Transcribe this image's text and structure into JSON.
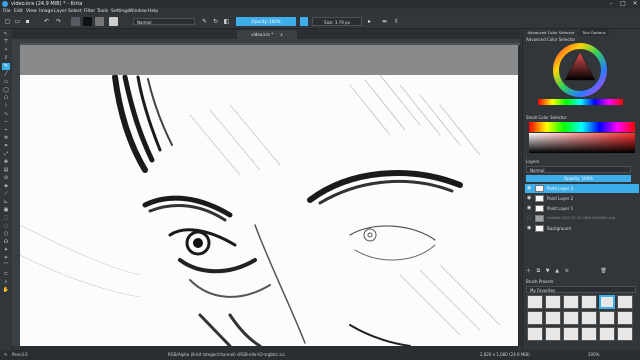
{
  "window": {
    "title": "video.kra (24.9 MiB) * - Krita",
    "minimize": "–",
    "maximize": "□",
    "close": "✕"
  },
  "menu": [
    "File",
    "Edit",
    "View",
    "Image",
    "Layer",
    "Select",
    "Filter",
    "Tools",
    "Settings",
    "Window",
    "Help"
  ],
  "toolbar": {
    "blend_mode": "Normal",
    "opacity_label": "Opacity: 100%",
    "size_label": "Size: 3.79 px"
  },
  "document_tab": {
    "label": "video.kra *",
    "close": "x"
  },
  "dock": {
    "color_tabs": [
      "Advanced Color Selector",
      "Tool Options"
    ],
    "advanced_color_selector_label": "Advanced Color Selector",
    "small_color_selector_label": "Small Color Selector",
    "layers_title": "Layers",
    "blend_mode": "Normal",
    "opacity_label": "Opacity: 100%",
    "layers": [
      {
        "name": "Paint Layer 3",
        "selected": true
      },
      {
        "name": "Paint Layer 2",
        "selected": false
      },
      {
        "name": "Paint Layer 1",
        "selected": false
      },
      {
        "name": "Untitled-2022-07-12-0849-800x800.png",
        "selected": false,
        "dim": true
      },
      {
        "name": "Background",
        "selected": false
      }
    ],
    "brush_presets_title": "Brush Presets",
    "brush_tag": "My Favorites"
  },
  "status": {
    "brush": "Pencil-2",
    "color_info": "RGB/Alpha (8-bit integer/channel)  sRGB-elle-V2-srgbtrc.icc",
    "dimensions": "2,820 x 1,080 (24.9 MiB)",
    "zoom": "200%"
  },
  "colors": {
    "accent": "#3daee9",
    "bg": "#31363b",
    "paper": "#fcfcfc"
  }
}
